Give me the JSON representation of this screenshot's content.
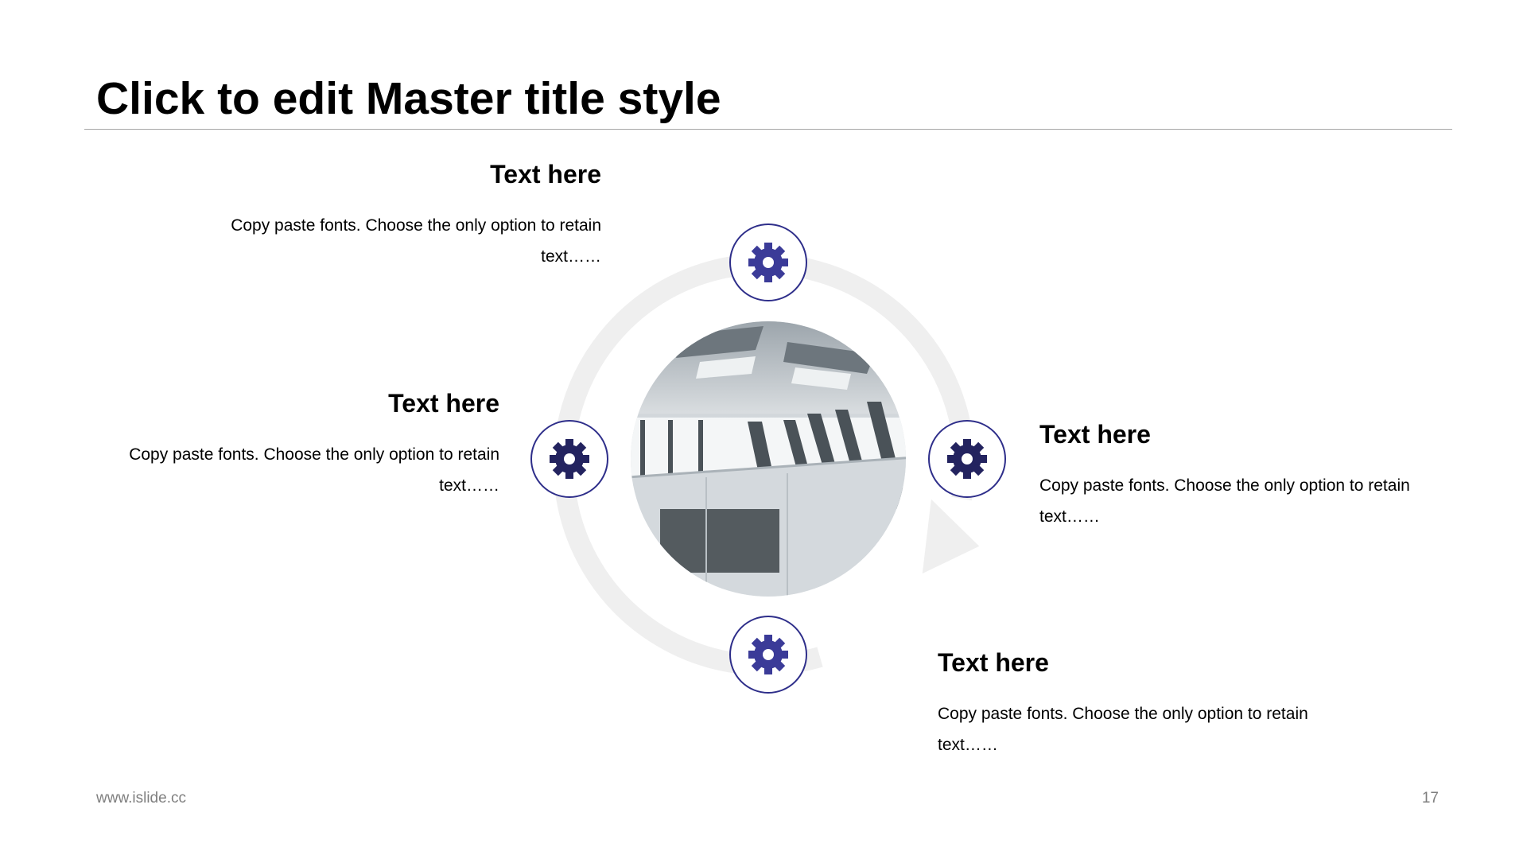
{
  "slide": {
    "title": "Click to edit Master title style",
    "footer_url": "www.islide.cc",
    "page_number": "17"
  },
  "blocks": [
    {
      "heading": "Text here",
      "body": "Copy paste fonts. Choose the only option to retain text……"
    },
    {
      "heading": "Text here",
      "body": "Copy paste fonts. Choose the only option to retain text……"
    },
    {
      "heading": "Text here",
      "body": "Copy paste fonts. Choose the only option to retain text……"
    },
    {
      "heading": "Text here",
      "body": "Copy paste fonts. Choose the only option to retain text……"
    }
  ],
  "diagram": {
    "node_icons": [
      "gear-icon",
      "gear-icon",
      "gear-icon",
      "gear-icon"
    ],
    "center_image": "modern-office-interior-photo"
  },
  "colors": {
    "accent": "#3b3b98",
    "node_border": "#2e2e8a",
    "cycle_ring": "#efefef",
    "rule": "#a6a6a6",
    "footer_text": "#7f7f7f"
  }
}
